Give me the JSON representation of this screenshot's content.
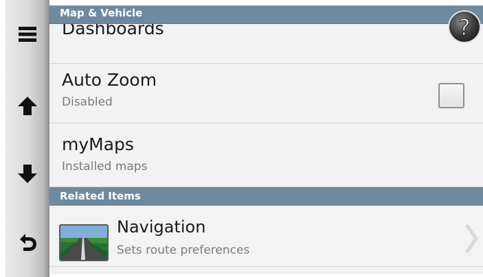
{
  "header": {
    "title": "Map & Vehicle"
  },
  "sidebar": {
    "items": [
      {
        "icon": "menu-icon"
      },
      {
        "icon": "arrow-up-icon"
      },
      {
        "icon": "arrow-down-icon"
      },
      {
        "icon": "back-icon"
      }
    ]
  },
  "help": {
    "label": "?"
  },
  "list": {
    "dashboards": {
      "title": "Dashboards"
    },
    "auto_zoom": {
      "title": "Auto Zoom",
      "subtitle": "Disabled",
      "checked": false
    },
    "mymaps": {
      "title": "myMaps",
      "subtitle": "Installed maps"
    }
  },
  "related": {
    "title": "Related Items",
    "items": [
      {
        "title": "Navigation",
        "subtitle": "Sets route preferences",
        "icon": "road-icon"
      }
    ]
  },
  "colors": {
    "header_blue": "#6d8a9f",
    "list_bg": "#f2f2f2"
  }
}
